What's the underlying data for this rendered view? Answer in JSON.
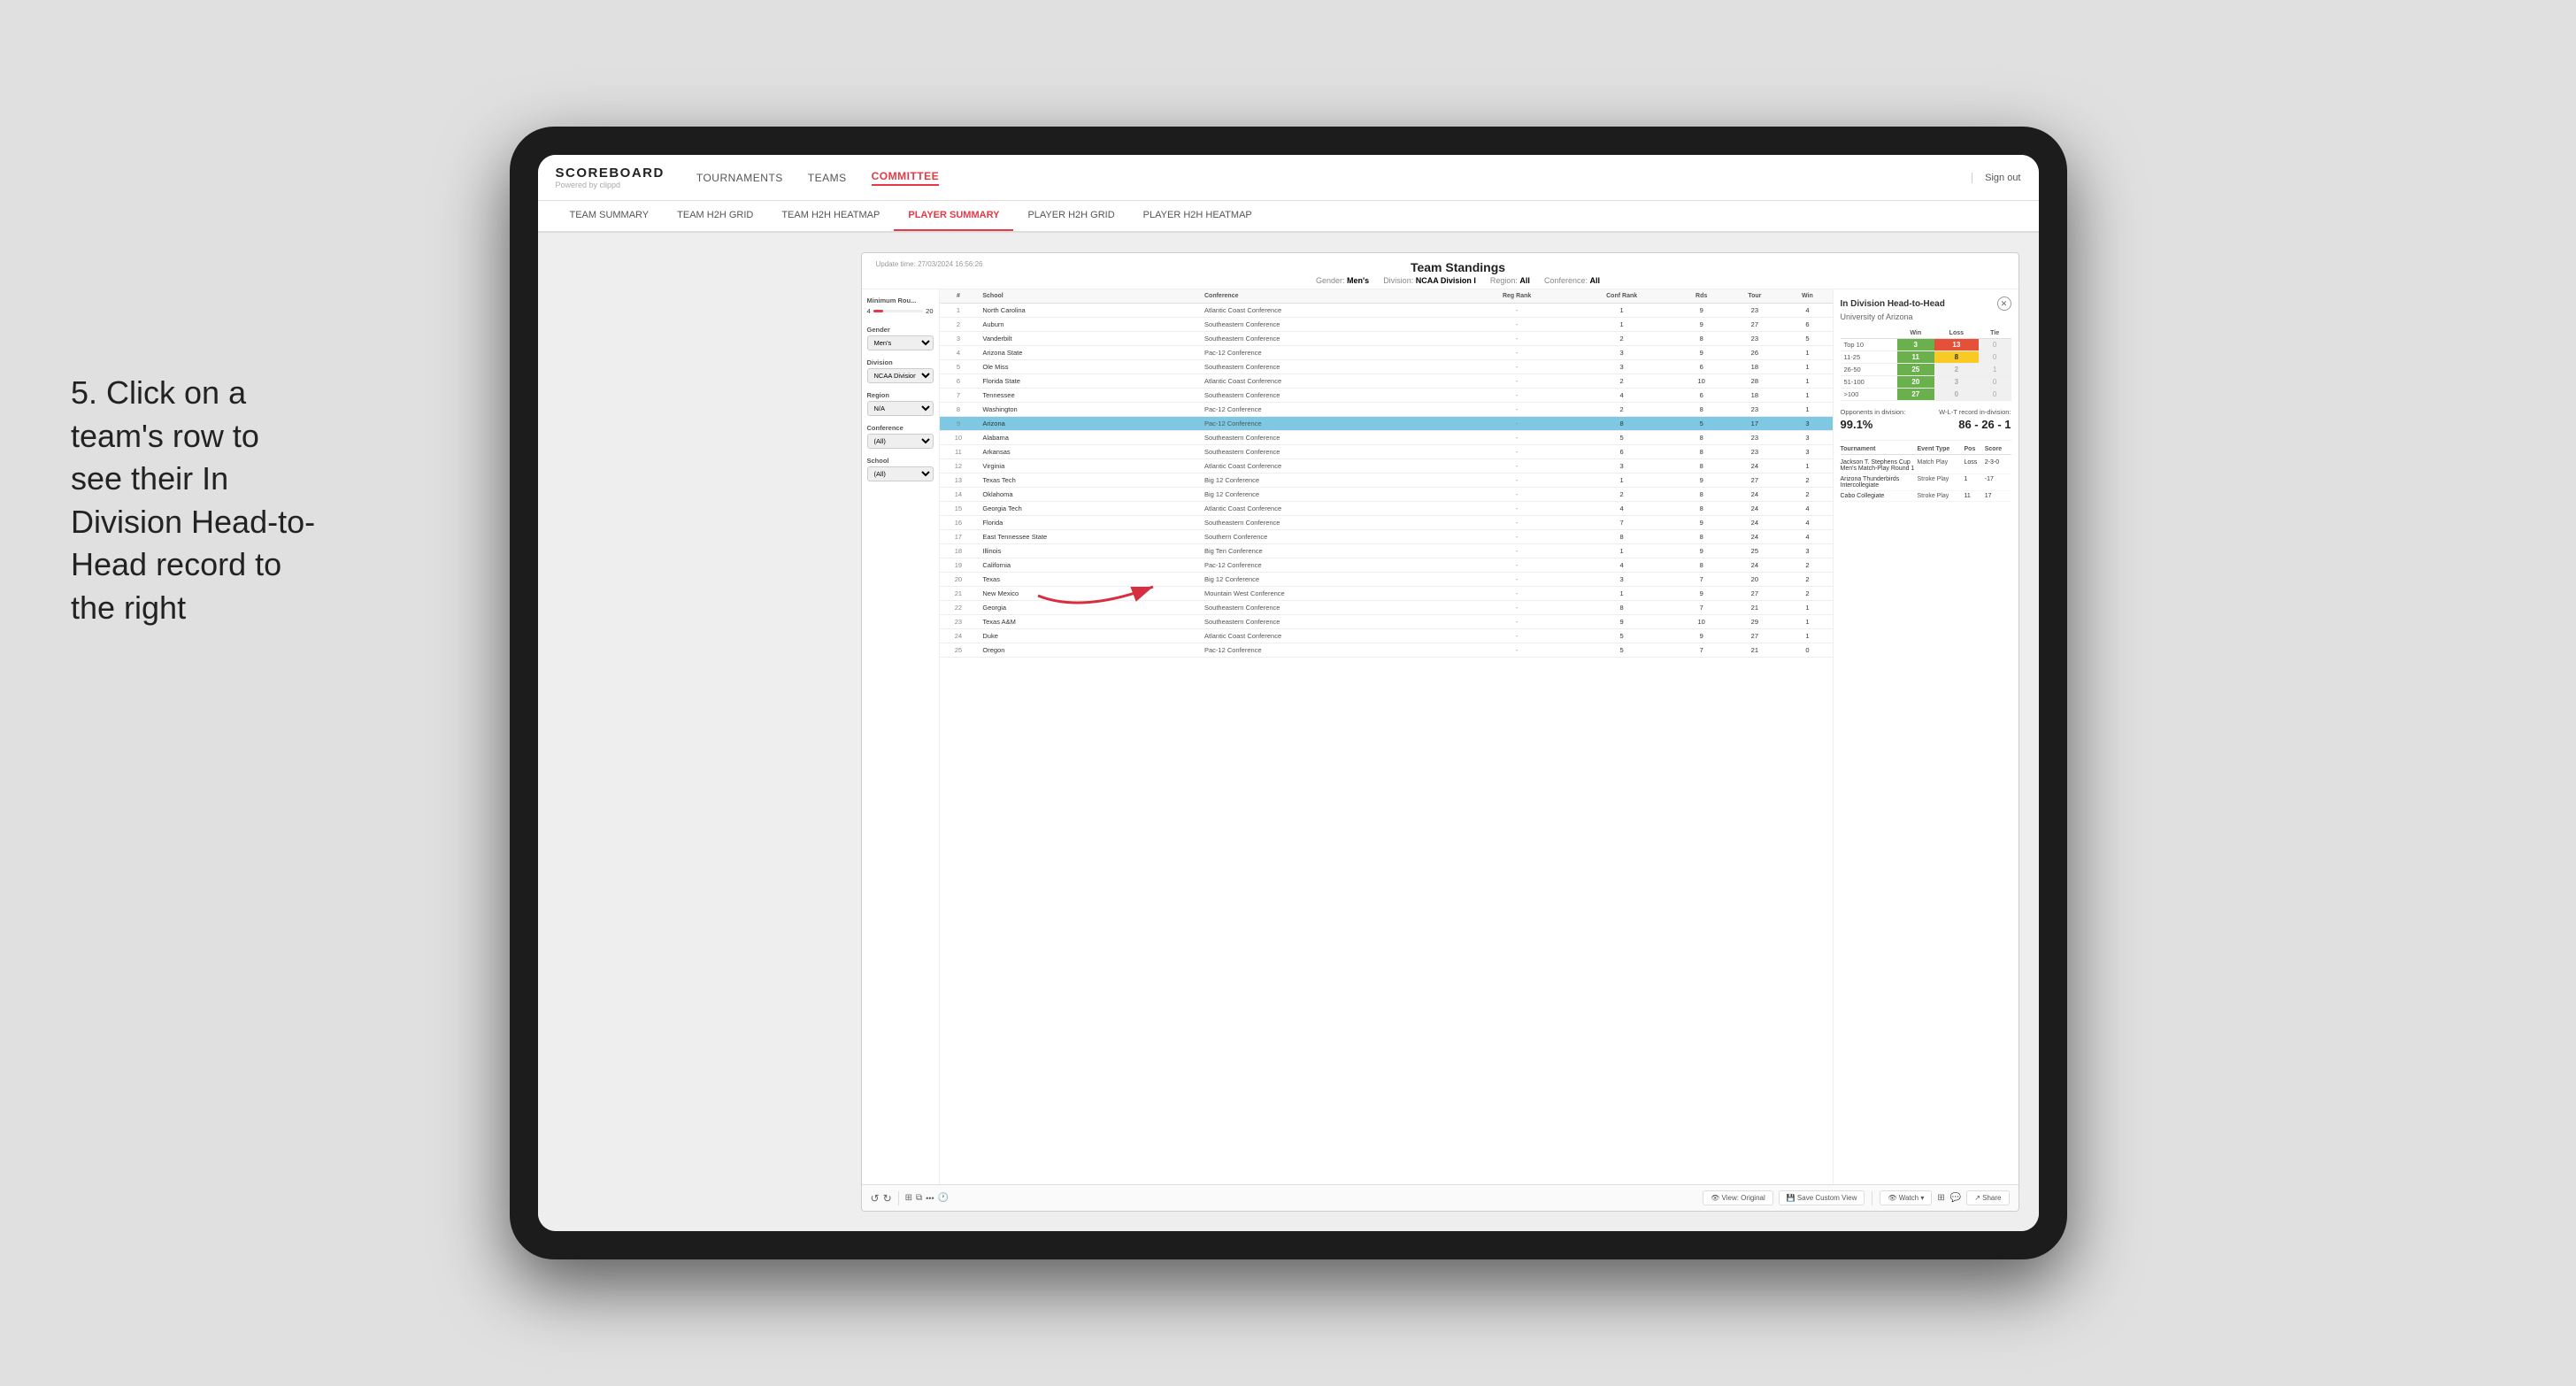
{
  "page": {
    "background": "#e8e8e8"
  },
  "nav": {
    "logo": "SCOREBOARD",
    "logo_sub": "Powered by clippd",
    "links": [
      "TOURNAMENTS",
      "TEAMS",
      "COMMITTEE"
    ],
    "active_link": "COMMITTEE",
    "sign_out": "Sign out",
    "sub_links": [
      "TEAM SUMMARY",
      "TEAM H2H GRID",
      "TEAM H2H HEATMAP",
      "PLAYER SUMMARY",
      "PLAYER H2H GRID",
      "PLAYER H2H HEATMAP"
    ],
    "active_sub": "PLAYER SUMMARY"
  },
  "instruction": {
    "text": "5. Click on a team's row to see their In Division Head-to-Head record to the right"
  },
  "dashboard": {
    "update_time_label": "Update time:",
    "update_time": "27/03/2024 16:56:26",
    "title": "Team Standings",
    "gender_label": "Gender:",
    "gender": "Men's",
    "division_label": "Division:",
    "division": "NCAA Division I",
    "region_label": "Region:",
    "region": "All",
    "conference_label": "Conference:",
    "conference": "All"
  },
  "filters": {
    "min_rounds_label": "Minimum Rou...",
    "min_rounds_val": "4",
    "min_rounds_max": "20",
    "gender_label": "Gender",
    "gender_val": "Men's",
    "division_label": "Division",
    "division_val": "NCAA Division I",
    "region_label": "Region",
    "region_val": "N/A",
    "conference_label": "Conference",
    "conference_val": "(All)",
    "school_label": "School",
    "school_val": "(All)"
  },
  "table": {
    "headers": [
      "#",
      "School",
      "Conference",
      "Reg Rank",
      "Conf Rank",
      "Rds",
      "Tour",
      "Win"
    ],
    "rows": [
      {
        "num": "1",
        "school": "North Carolina",
        "conf": "Atlantic Coast Conference",
        "reg": "-",
        "crank": "1",
        "rds": "9",
        "tour": "23",
        "win": "4",
        "highlighted": false
      },
      {
        "num": "2",
        "school": "Auburn",
        "conf": "Southeastern Conference",
        "reg": "-",
        "crank": "1",
        "rds": "9",
        "tour": "27",
        "win": "6",
        "highlighted": false
      },
      {
        "num": "3",
        "school": "Vanderbilt",
        "conf": "Southeastern Conference",
        "reg": "-",
        "crank": "2",
        "rds": "8",
        "tour": "23",
        "win": "5",
        "highlighted": false
      },
      {
        "num": "4",
        "school": "Arizona State",
        "conf": "Pac-12 Conference",
        "reg": "-",
        "crank": "3",
        "rds": "9",
        "tour": "26",
        "win": "1",
        "highlighted": false
      },
      {
        "num": "5",
        "school": "Ole Miss",
        "conf": "Southeastern Conference",
        "reg": "-",
        "crank": "3",
        "rds": "6",
        "tour": "18",
        "win": "1",
        "highlighted": false
      },
      {
        "num": "6",
        "school": "Florida State",
        "conf": "Atlantic Coast Conference",
        "reg": "-",
        "crank": "2",
        "rds": "10",
        "tour": "28",
        "win": "1",
        "highlighted": false
      },
      {
        "num": "7",
        "school": "Tennessee",
        "conf": "Southeastern Conference",
        "reg": "-",
        "crank": "4",
        "rds": "6",
        "tour": "18",
        "win": "1",
        "highlighted": false
      },
      {
        "num": "8",
        "school": "Washington",
        "conf": "Pac-12 Conference",
        "reg": "-",
        "crank": "2",
        "rds": "8",
        "tour": "23",
        "win": "1",
        "highlighted": false
      },
      {
        "num": "9",
        "school": "Arizona",
        "conf": "Pac-12 Conference",
        "reg": "-",
        "crank": "8",
        "rds": "5",
        "tour": "17",
        "win": "3",
        "highlighted": true
      },
      {
        "num": "10",
        "school": "Alabama",
        "conf": "Southeastern Conference",
        "reg": "-",
        "crank": "5",
        "rds": "8",
        "tour": "23",
        "win": "3",
        "highlighted": false
      },
      {
        "num": "11",
        "school": "Arkansas",
        "conf": "Southeastern Conference",
        "reg": "-",
        "crank": "6",
        "rds": "8",
        "tour": "23",
        "win": "3",
        "highlighted": false
      },
      {
        "num": "12",
        "school": "Virginia",
        "conf": "Atlantic Coast Conference",
        "reg": "-",
        "crank": "3",
        "rds": "8",
        "tour": "24",
        "win": "1",
        "highlighted": false
      },
      {
        "num": "13",
        "school": "Texas Tech",
        "conf": "Big 12 Conference",
        "reg": "-",
        "crank": "1",
        "rds": "9",
        "tour": "27",
        "win": "2",
        "highlighted": false
      },
      {
        "num": "14",
        "school": "Oklahoma",
        "conf": "Big 12 Conference",
        "reg": "-",
        "crank": "2",
        "rds": "8",
        "tour": "24",
        "win": "2",
        "highlighted": false
      },
      {
        "num": "15",
        "school": "Georgia Tech",
        "conf": "Atlantic Coast Conference",
        "reg": "-",
        "crank": "4",
        "rds": "8",
        "tour": "24",
        "win": "4",
        "highlighted": false
      },
      {
        "num": "16",
        "school": "Florida",
        "conf": "Southeastern Conference",
        "reg": "-",
        "crank": "7",
        "rds": "9",
        "tour": "24",
        "win": "4",
        "highlighted": false
      },
      {
        "num": "17",
        "school": "East Tennessee State",
        "conf": "Southern Conference",
        "reg": "-",
        "crank": "8",
        "rds": "8",
        "tour": "24",
        "win": "4",
        "highlighted": false
      },
      {
        "num": "18",
        "school": "Illinois",
        "conf": "Big Ten Conference",
        "reg": "-",
        "crank": "1",
        "rds": "9",
        "tour": "25",
        "win": "3",
        "highlighted": false
      },
      {
        "num": "19",
        "school": "California",
        "conf": "Pac-12 Conference",
        "reg": "-",
        "crank": "4",
        "rds": "8",
        "tour": "24",
        "win": "2",
        "highlighted": false
      },
      {
        "num": "20",
        "school": "Texas",
        "conf": "Big 12 Conference",
        "reg": "-",
        "crank": "3",
        "rds": "7",
        "tour": "20",
        "win": "2",
        "highlighted": false
      },
      {
        "num": "21",
        "school": "New Mexico",
        "conf": "Mountain West Conference",
        "reg": "-",
        "crank": "1",
        "rds": "9",
        "tour": "27",
        "win": "2",
        "highlighted": false
      },
      {
        "num": "22",
        "school": "Georgia",
        "conf": "Southeastern Conference",
        "reg": "-",
        "crank": "8",
        "rds": "7",
        "tour": "21",
        "win": "1",
        "highlighted": false
      },
      {
        "num": "23",
        "school": "Texas A&M",
        "conf": "Southeastern Conference",
        "reg": "-",
        "crank": "9",
        "rds": "10",
        "tour": "29",
        "win": "1",
        "highlighted": false
      },
      {
        "num": "24",
        "school": "Duke",
        "conf": "Atlantic Coast Conference",
        "reg": "-",
        "crank": "5",
        "rds": "9",
        "tour": "27",
        "win": "1",
        "highlighted": false
      },
      {
        "num": "25",
        "school": "Oregon",
        "conf": "Pac-12 Conference",
        "reg": "-",
        "crank": "5",
        "rds": "7",
        "tour": "21",
        "win": "0",
        "highlighted": false
      }
    ]
  },
  "h2h": {
    "title": "In Division Head-to-Head",
    "team": "University of Arizona",
    "win_label": "Win",
    "loss_label": "Loss",
    "tie_label": "Tie",
    "ranges": [
      {
        "label": "Top 10",
        "win": "3",
        "loss": "13",
        "tie": "0",
        "win_class": "cell-green",
        "loss_class": "cell-red",
        "tie_class": "cell-gray"
      },
      {
        "label": "11-25",
        "win": "11",
        "loss": "8",
        "tie": "0",
        "win_class": "cell-green",
        "loss_class": "cell-yellow",
        "tie_class": "cell-gray"
      },
      {
        "label": "26-50",
        "win": "25",
        "loss": "2",
        "tie": "1",
        "win_class": "cell-green",
        "loss_class": "cell-gray",
        "tie_class": "cell-gray"
      },
      {
        "label": "51-100",
        "win": "20",
        "loss": "3",
        "tie": "0",
        "win_class": "cell-green",
        "loss_class": "cell-gray",
        "tie_class": "cell-gray"
      },
      {
        "label": ">100",
        "win": "27",
        "loss": "0",
        "tie": "0",
        "win_class": "cell-green",
        "loss_class": "cell-gray",
        "tie_class": "cell-gray"
      }
    ],
    "opponents_pct_label": "Opponents in division:",
    "opponents_pct": "99.1%",
    "wlt_label": "W-L-T record in-division:",
    "wlt": "86 - 26 - 1",
    "tournaments": [
      {
        "name": "Jackson T. Stephens Cup Men's Match-Play Round 1",
        "type": "Match Play",
        "pos": "Loss",
        "score": "2-3-0"
      },
      {
        "name": "Arizona Thunderbirds Intercollegiate",
        "type": "Stroke Play",
        "pos": "1",
        "score": "-17"
      },
      {
        "name": "Cabo Collegiate",
        "type": "Stroke Play",
        "pos": "11",
        "score": "17"
      }
    ],
    "tournament_headers": [
      "Tournament",
      "Event Type",
      "Pos",
      "Score"
    ]
  },
  "toolbar": {
    "undo": "↺",
    "items": [
      "View: Original",
      "Save Custom View",
      "Watch",
      "Share"
    ]
  }
}
